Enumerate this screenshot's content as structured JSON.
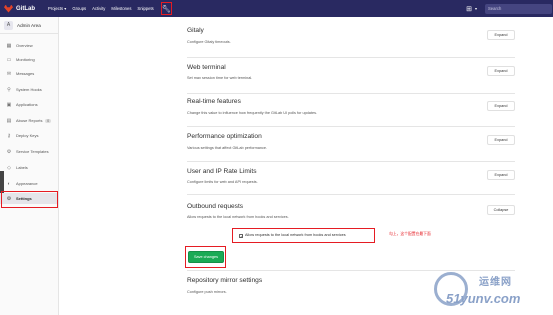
{
  "topbar": {
    "logo_text": "GitLab",
    "nav": [
      "Projects ▾",
      "Groups",
      "Activity",
      "Milestones",
      "Snippets"
    ],
    "admin_icon": "wrench-icon",
    "search_placeholder": "Search"
  },
  "sidebar": {
    "header": {
      "avatar": "A",
      "title": "Admin Area"
    },
    "items": [
      {
        "label": "Overview",
        "icon": "▦"
      },
      {
        "label": "Monitoring",
        "icon": "▭"
      },
      {
        "label": "Messages",
        "icon": "✉"
      },
      {
        "label": "System Hooks",
        "icon": "⚲"
      },
      {
        "label": "Applications",
        "icon": "▣"
      },
      {
        "label": "Abuse Reports",
        "icon": "▤",
        "count": "0"
      },
      {
        "label": "Deploy Keys",
        "icon": "⚷"
      },
      {
        "label": "Service Templates",
        "icon": "⚙"
      },
      {
        "label": "Labels",
        "icon": "◇"
      },
      {
        "label": "Appearance",
        "icon": "◐"
      },
      {
        "label": "Settings",
        "icon": "⚙",
        "active": true
      }
    ]
  },
  "sections": [
    {
      "title": "Gitaly",
      "desc": "Configure Gitaly timeouts.",
      "button": "Expand"
    },
    {
      "title": "Web terminal",
      "desc": "Set max session time for web terminal.",
      "button": "Expand"
    },
    {
      "title": "Real-time features",
      "desc": "Change this value to influence how frequently the GitLab UI polls for updates.",
      "button": "Expand"
    },
    {
      "title": "Performance optimization",
      "desc": "Various settings that affect GitLab performance.",
      "button": "Expand"
    },
    {
      "title": "User and IP Rate Limits",
      "desc": "Configure limits for web and API requests.",
      "button": "Expand"
    },
    {
      "title": "Outbound requests",
      "desc": "Allow requests to the local network from hooks and services.",
      "button": "Collapse"
    },
    {
      "title": "Repository mirror settings",
      "desc": "Configure push mirrors.",
      "button": ""
    }
  ],
  "outbound": {
    "checkbox_label": "Allow requests to the local network from hooks and services",
    "checked": true,
    "annotation": "勾上，这个配置在最下面",
    "save_button": "Save changes"
  },
  "watermark": {
    "top": "运维网",
    "bottom": "51yunv.com"
  },
  "colors": {
    "topbar": "#292961",
    "accent_red": "#e51c23",
    "save_green": "#1aaa55"
  }
}
